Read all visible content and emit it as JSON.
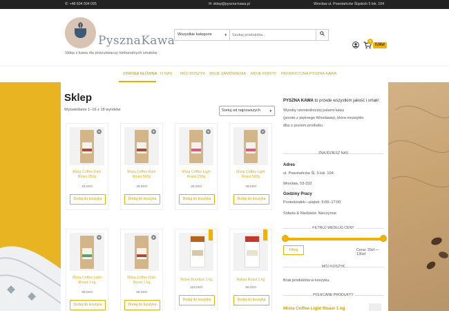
{
  "topbar": {
    "phone": "+48 604 504 035",
    "email": "sklep@pyszna-kawa.pl",
    "address": "Wrocław ul. Powstańców Śląskich 5 lok. 104"
  },
  "brand": {
    "name": "PysznaKawa",
    "tagline": "Sklep z kawa dla poszukwaczy niebanalnych smaków",
    "colors": {
      "accent": "#e5b100",
      "link": "#d49f00",
      "logo_bg": "#d9c3b2"
    }
  },
  "search": {
    "category": "Wszystkie kategorie",
    "placeholder": "Szukaj produktów..."
  },
  "cart": {
    "count": "0",
    "total": "0,00zł"
  },
  "nav": {
    "items": [
      {
        "label": "Strona główna",
        "active": true
      },
      {
        "label": "O nas"
      },
      {
        "label": "Mój koszyk"
      },
      {
        "label": "Moje zamówienia"
      },
      {
        "label": "Moje konto"
      },
      {
        "label": "Promocyjna Pyszna Kawa"
      }
    ]
  },
  "shop": {
    "title": "Sklep",
    "result_count": "Wyświetlanie 1–16 z 18 wyników",
    "sort": "Sortuj od najnowszych"
  },
  "products": [
    {
      "name": "Mista Coffee Dark Roast 250g",
      "price": "29,00zł",
      "button": "Dodaj do koszyka"
    },
    {
      "name": "Mista Coffee Dark Roast 500g",
      "price": "49,00zł",
      "button": "Dodaj do koszyka"
    },
    {
      "name": "Mista Coffee Light Roast 250g",
      "price": "29,00zł",
      "button": "Dodaj do koszyka"
    },
    {
      "name": "Mista Coffee Light Roast 500g",
      "price": "49,00zł",
      "button": "Dodaj do koszyka"
    },
    {
      "name": "Mista Coffee Light Roast 1 kg",
      "price": "89,00zł",
      "button": "Dodaj do koszyka"
    },
    {
      "name": "Mista Coffee Dark Roast 1 kg",
      "price": "89,00zł",
      "button": "Dodaj do koszyka"
    },
    {
      "name": "Yellow Bourbon 1 kg",
      "price": "119,00zł",
      "button": "Dodaj do koszyka"
    },
    {
      "name": "Rakas Roast 1 kg",
      "price": "99,00zł",
      "button": "Dodaj do koszyka"
    }
  ],
  "sidebar": {
    "intro_bold": "PYSZNA KAWA",
    "intro_rest": " to przede wszystkim jakość i smak!",
    "intro_text_1": "Wyroby rzemieślniczej palarni kawy",
    "intro_text_2": "(prosto z pięknego Wrocławia), która niezwykle",
    "intro_text_3": "dba o poziom produktu.",
    "find_us": "Znajdziesz nas",
    "address_label": "Adres",
    "address_line1": "ul. Powstańców Śl. 5 lok. 104",
    "address_line2": "Wrocław, 53-332",
    "hours_label": "Godziny Pracy",
    "hours_line1": "Poniedziałek—piątek: 9:00–17:00",
    "hours_line2": "Sobota & Niedziela: Nieczynne",
    "filter_title": "Filtruj według ceny",
    "filter_button": "Filtruj",
    "price_range": "Cena: 20zł — 130zł",
    "cart_title": "Mój koszyk",
    "cart_empty": "Brak produktów w koszyku.",
    "featured_title": "Polecane produkty",
    "featured_name": "Mista Coffee Light Roast 1 kg"
  }
}
